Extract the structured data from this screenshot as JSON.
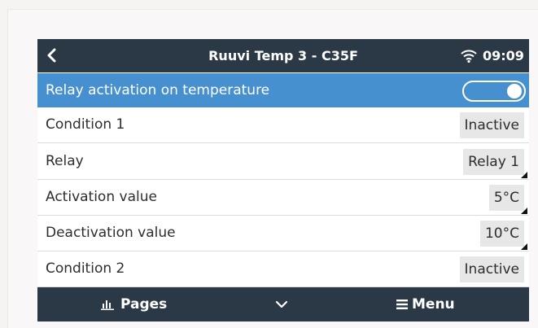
{
  "header": {
    "title": "Ruuvi Temp 3 - C35F",
    "time": "09:09",
    "back_icon": "chevron-left-icon",
    "wifi_icon": "wifi-icon"
  },
  "toggle_row": {
    "label": "Relay activation on temperature",
    "enabled": true
  },
  "rows": [
    {
      "label": "Condition 1",
      "value": "Inactive",
      "editable": false
    },
    {
      "label": "Relay",
      "value": "Relay 1",
      "editable": true
    },
    {
      "label": "Activation value",
      "value": "5°C",
      "editable": true
    },
    {
      "label": "Deactivation value",
      "value": "10°C",
      "editable": true
    },
    {
      "label": "Condition 2",
      "value": "Inactive",
      "editable": false
    }
  ],
  "footer": {
    "pages_label": "Pages",
    "menu_label": "Menu",
    "pages_icon": "bar-chart-icon",
    "chevron_icon": "chevron-down-icon",
    "menu_icon": "hamburger-icon"
  },
  "colors": {
    "header_bg": "#2b3845",
    "highlight_bg": "#4790d0",
    "value_bg": "#e7e7e7"
  }
}
